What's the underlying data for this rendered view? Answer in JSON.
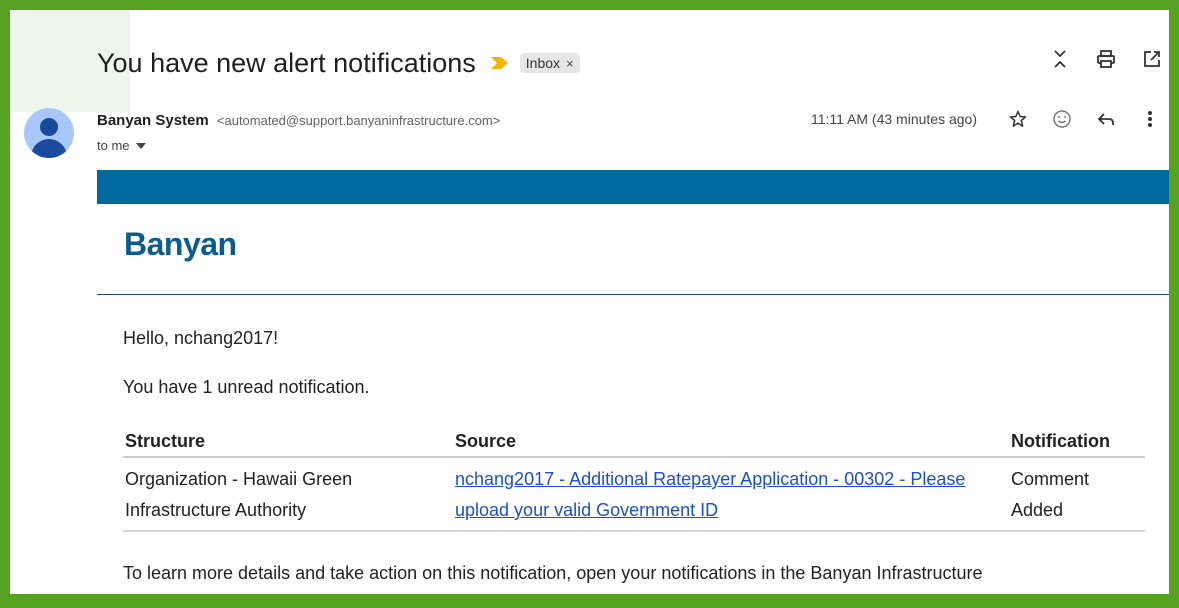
{
  "email": {
    "subject": "You have new alert notifications",
    "label": "Inbox",
    "label_remove": "×",
    "sender_name": "Banyan System",
    "sender_email": "<automated@support.banyaninfrastructure.com>",
    "to": "to me",
    "time": "11:11 AM (43 minutes ago)"
  },
  "icons": {
    "importance": "importance-marker-icon",
    "collapse": "collapse-icon",
    "print": "print-icon",
    "open_new": "open-in-new-window-icon",
    "star": "star-icon",
    "emoji": "emoji-icon",
    "reply": "reply-icon",
    "more": "more-vert-icon",
    "dropdown": "chevron-down-icon"
  },
  "colors": {
    "frame_border": "#56a222",
    "banner": "#006b9e",
    "logo": "#0b5c8e",
    "link": "#1a4fd6",
    "importance": "#f4b400"
  },
  "body": {
    "logo_text": "Banyan",
    "greeting": "Hello, nchang2017!",
    "unread": "You have 1 unread notification.",
    "table": {
      "headers": [
        "Structure",
        "Source",
        "Notification"
      ],
      "rows": [
        {
          "structure": "Organization - Hawaii Green Infrastructure Authority",
          "source": "nchang2017 - Additional Ratepayer Application - 00302 - Please upload your valid Government ID",
          "notification": "Comment Added"
        }
      ]
    },
    "footer": "To learn more details and take action on this notification, open your notifications in the Banyan Infrastructure"
  }
}
